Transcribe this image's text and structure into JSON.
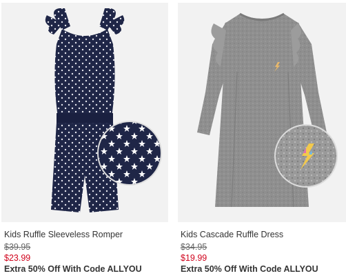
{
  "products": [
    {
      "name": "Kids Ruffle Sleeveless Romper",
      "original_price": "$39.95",
      "sale_price": "$23.99",
      "promo": "Extra 50% Off With Code ALLYOU",
      "image_description_icon": "romper-image",
      "main_color": "#1f2647",
      "pattern_color": "#ffffff"
    },
    {
      "name": "Kids Cascade Ruffle Dress",
      "original_price": "$34.95",
      "sale_price": "$19.99",
      "promo": "Extra 50% Off With Code ALLYOU",
      "image_description_icon": "dress-image",
      "main_color": "#8e8e8e"
    }
  ],
  "colors": {
    "sale": "#d0021b",
    "text": "#333333",
    "muted": "#666666",
    "image_bg": "#f2f2f2"
  }
}
